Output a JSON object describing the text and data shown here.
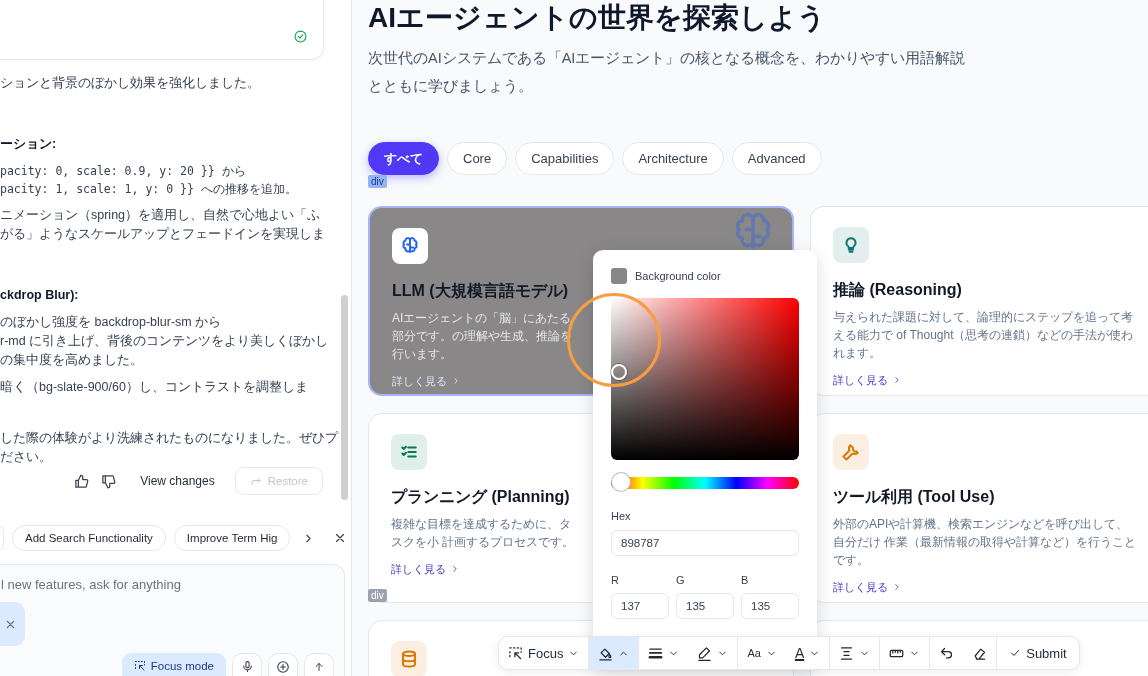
{
  "chat": {
    "blocks": [
      {
        "kind": "paragraph",
        "lines": [
          "ションと背景のぼかし効果を強化しました。"
        ]
      },
      {
        "kind": "heading",
        "lines": [
          "ーション:"
        ]
      },
      {
        "kind": "code",
        "lines": [
          "pacity: 0, scale: 0.9, y: 20 }} から",
          "pacity: 1, scale: 1, y: 0 }} への推移を追加。"
        ]
      },
      {
        "kind": "paragraph",
        "lines": [
          "ニメーション（spring）を適用し、自然で心地よい「ふ",
          "がる」ようなスケールアップとフェードインを実現しま"
        ]
      },
      {
        "kind": "heading",
        "lines": [
          "ckdrop Blur):"
        ]
      },
      {
        "kind": "paragraph",
        "lines": [
          "のぼかし強度を backdrop-blur-sm から",
          "r-md に引き上げ、背後のコンテンツをより美しくぼかし",
          "の集中度を高めました。"
        ]
      },
      {
        "kind": "paragraph",
        "lines": [
          "暗く（bg-slate-900/60）し、コントラストを調整しま"
        ]
      },
      {
        "kind": "closing",
        "lines": [
          "した際の体験がより洗練されたものになりました。ぜひプ",
          "ださい。"
        ]
      }
    ],
    "view_changes": "View changes",
    "restore": {
      "label": "Restore",
      "disabled": true
    },
    "suggestions": [
      "Add Search Functionality",
      "Improve Term Hig"
    ],
    "composer": {
      "placeholder": "l new features, ask for anything",
      "focus_mode": {
        "label": "Focus mode",
        "selected": true
      }
    }
  },
  "page": {
    "title": "AIエージェントの世界を探索しよう",
    "subtitle": "次世代のAIシステムである「AIエージェント」の核となる概念を、わかりやすい用語解説とともに学びましょう。",
    "filters": [
      {
        "label": "すべて",
        "selected": true
      },
      {
        "label": "Core",
        "selected": false
      },
      {
        "label": "Capabilities",
        "selected": false
      },
      {
        "label": "Architecture",
        "selected": false
      },
      {
        "label": "Advanced",
        "selected": false
      }
    ],
    "element_tags": [
      "div",
      "div"
    ],
    "cards": [
      {
        "kind": "brain",
        "color": "#2563eb",
        "title": "LLM (大規模言語モデル)",
        "description": "AIエージェントの「脳」にあたる部分です。の理解や生成、推論を行います。",
        "link": "詳しく見る",
        "selected": true
      },
      {
        "kind": "bulb",
        "color": "#0f766e",
        "title": "推論 (Reasoning)",
        "description": "与えられた課題に対して、論理的にステップを追って考える能力で of Thought（思考の連鎖）などの手法が使われます。",
        "link": "詳しく見る",
        "selected": false
      },
      {
        "kind": "checklist",
        "color": "#047857",
        "title": "プランニング (Planning)",
        "description": "複雑な目標を達成するために、タスクを小 計画するプロセスです。",
        "link": "詳しく見る",
        "selected": false
      },
      {
        "kind": "wrench",
        "color": "#d97706",
        "title": "ツール利用 (Tool Use)",
        "description": "外部のAPIや計算機、検索エンジンなどを呼び出して、自分だけ 作業（最新情報の取得や計算など）を行うことです。",
        "link": "詳しく見る",
        "selected": false
      },
      {
        "kind": "database",
        "color": "#d97706",
        "selected": false
      },
      {
        "kind": "blank",
        "selected": false
      }
    ]
  },
  "color_picker": {
    "label": "Background color",
    "hex_label": "Hex",
    "hex": "898787",
    "hue": {
      "level": 0
    },
    "channels": [
      {
        "label": "R",
        "value": "137"
      },
      {
        "label": "G",
        "value": "135"
      },
      {
        "label": "B",
        "value": "135"
      }
    ]
  },
  "toolbar": [
    {
      "kind": "focus",
      "label": "Focus",
      "selected": false
    },
    {
      "kind": "fill",
      "selected": true
    },
    {
      "kind": "stroke",
      "selected": false
    },
    {
      "kind": "pen",
      "selected": false
    },
    {
      "kind": "font-size",
      "label": "Aa",
      "selected": false
    },
    {
      "kind": "text-color",
      "label": "A",
      "selected": false
    },
    {
      "kind": "align",
      "selected": false
    },
    {
      "kind": "ruler",
      "selected": false
    },
    {
      "kind": "undo",
      "selected": false
    },
    {
      "kind": "eraser",
      "selected": false
    },
    {
      "kind": "submit",
      "label": "Submit",
      "selected": false
    }
  ]
}
